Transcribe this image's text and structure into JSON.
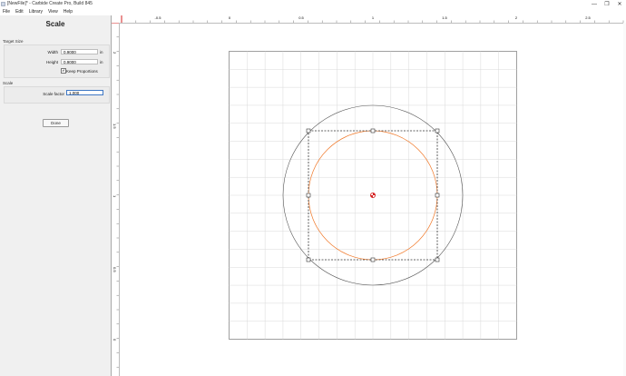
{
  "window": {
    "title": "[NewFile]* - Carbide Create Pro, Build 845",
    "controls": [
      "—",
      "❐",
      "✕"
    ]
  },
  "menu": {
    "items": [
      "File",
      "Edit",
      "Library",
      "View",
      "Help"
    ]
  },
  "panel": {
    "title": "Scale",
    "target_size_label": "Target Size",
    "width_label": "Width",
    "width_value": "0.9000",
    "width_unit": "in",
    "height_label": "Height",
    "height_value": "0.9000",
    "height_unit": "in",
    "keep_proportions_label": "Keep Proportions",
    "keep_proportions_checked": true,
    "scale_section_label": "Scale",
    "scale_factor_label": "Scale factor",
    "scale_factor_value": "1.000",
    "done_label": "Done"
  },
  "ruler": {
    "top_labels": [
      "-0.5",
      "0",
      "0.5",
      "1",
      "1.5",
      "2",
      "2.5"
    ],
    "left_labels": [
      "2",
      "1.5",
      "1",
      "0.5",
      "0"
    ]
  },
  "colors": {
    "accent": "#3f78c4",
    "grid": "#d9d9d9",
    "origin": "#d42020",
    "toolpath_orange": "#f07828",
    "selection": "#333333"
  }
}
